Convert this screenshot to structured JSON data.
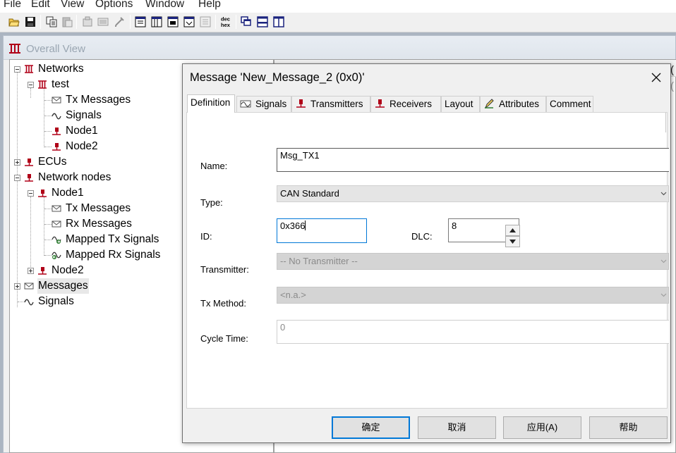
{
  "menubar": {
    "items": [
      "File",
      "Edit",
      "View",
      "Options",
      "Window",
      "Help"
    ]
  },
  "toolbar": {
    "buttons": [
      "open-icon",
      "save-icon",
      "copy-icon",
      "paste-icon",
      "properties-icon",
      "list-icon",
      "tools-icon",
      "view1-icon",
      "view2-icon",
      "view3-icon",
      "view4-icon",
      "view5-icon",
      "dec-hex-icon",
      "cascade-icon",
      "tile-horizontal-icon",
      "tile-vertical-icon"
    ],
    "dec_hex_top": "dec",
    "dec_hex_bottom": "hex"
  },
  "child_window": {
    "title": "Overall View"
  },
  "tree": {
    "nodes": [
      {
        "label": "Networks"
      },
      {
        "label": "test"
      },
      {
        "label": "Tx Messages"
      },
      {
        "label": "Signals"
      },
      {
        "label": "Node1"
      },
      {
        "label": "Node2"
      },
      {
        "label": "ECUs"
      },
      {
        "label": "Network nodes"
      },
      {
        "label": "Node1"
      },
      {
        "label": "Tx Messages"
      },
      {
        "label": "Rx Messages"
      },
      {
        "label": "Mapped Tx Signals"
      },
      {
        "label": "Mapped Rx Signals"
      },
      {
        "label": "Node2"
      },
      {
        "label": "Messages"
      },
      {
        "label": "Signals"
      }
    ]
  },
  "right_pane": {
    "glimpse_a": "(",
    "glimpse_b": "("
  },
  "dialog": {
    "title": "Message 'New_Message_2 (0x0)'",
    "tabs": [
      {
        "label": "Definition",
        "icon": ""
      },
      {
        "label": "Signals",
        "icon": "signal-icon"
      },
      {
        "label": "Transmitters",
        "icon": "node-icon"
      },
      {
        "label": "Receivers",
        "icon": "node-icon"
      },
      {
        "label": "Layout",
        "icon": ""
      },
      {
        "label": "Attributes",
        "icon": "pencil-icon"
      },
      {
        "label": "Comment",
        "icon": ""
      }
    ],
    "fields": {
      "name_label": "Name:",
      "name_value": "Msg_TX1",
      "type_label": "Type:",
      "type_value": "CAN Standard",
      "id_label": "ID:",
      "id_value": "0x366",
      "dlc_label": "DLC:",
      "dlc_value": "8",
      "transmitter_label": "Transmitter:",
      "transmitter_value": "-- No Transmitter --",
      "txmethod_label": "Tx Method:",
      "txmethod_value": "<n.a.>",
      "cycletime_label": "Cycle Time:",
      "cycletime_value": "0"
    },
    "buttons": {
      "ok": "确定",
      "cancel": "取消",
      "apply": "应用(A)",
      "help": "帮助"
    }
  },
  "colors": {
    "accent_focus": "#0078d7",
    "mdi_background": "#abb5c1",
    "node_icon": "#b00018"
  }
}
